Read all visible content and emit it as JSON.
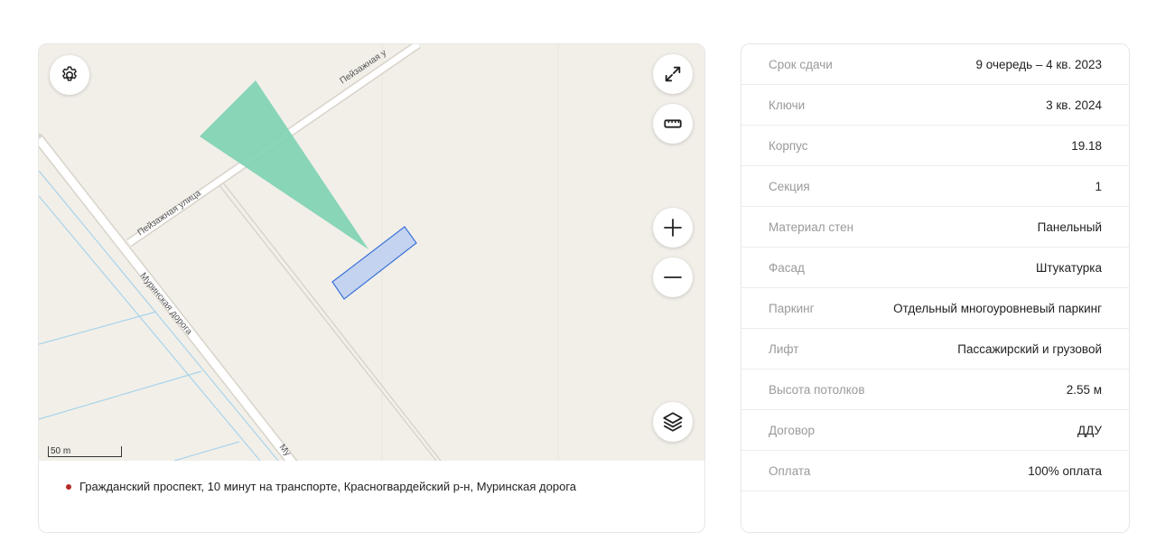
{
  "map": {
    "roads": {
      "peyzazhnaya_lower": "Пейзажная улица",
      "peyzazhnaya_upper": "Пейзажная у",
      "murinskaya": "Муринская дорога",
      "murinskaya_bottom": "Му"
    },
    "scale_label": "50 m",
    "controls": {
      "settings": "gear-icon",
      "fullscreen": "expand-icon",
      "ruler": "ruler-icon",
      "zoom_in": "plus-icon",
      "zoom_out": "minus-icon",
      "layers": "layers-icon"
    },
    "colors": {
      "background": "#f2efe9",
      "view_cone": "#7fd3b3",
      "building_fill": "#c4d3f0",
      "building_stroke": "#3a73d8",
      "water": "#a9d4ea"
    }
  },
  "address": {
    "text": "Гражданский проспект, 10 минут на транспорте, Красногвардейский р-н, Муринская дорога"
  },
  "details": [
    {
      "label": "Срок сдачи",
      "value": "9 очередь – 4 кв. 2023"
    },
    {
      "label": "Ключи",
      "value": "3 кв. 2024"
    },
    {
      "label": "Корпус",
      "value": "19.18"
    },
    {
      "label": "Секция",
      "value": "1"
    },
    {
      "label": "Материал стен",
      "value": "Панельный"
    },
    {
      "label": "Фасад",
      "value": "Штукатурка"
    },
    {
      "label": "Паркинг",
      "value": "Отдельный многоуровневый паркинг"
    },
    {
      "label": "Лифт",
      "value": "Пассажирский и грузовой"
    },
    {
      "label": "Высота потолков",
      "value": "2.55 м"
    },
    {
      "label": "Договор",
      "value": "ДДУ"
    },
    {
      "label": "Оплата",
      "value": "100% оплата"
    }
  ]
}
